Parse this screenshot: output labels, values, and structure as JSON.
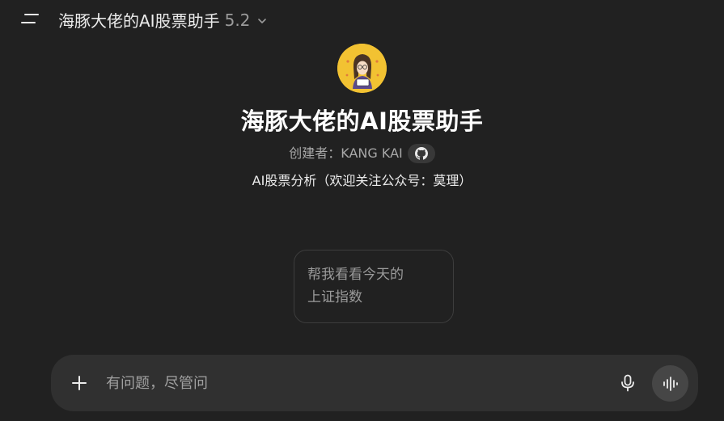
{
  "header": {
    "title": "海豚大佬的AI股票助手",
    "version": "5.2",
    "menu_icon": "sidebar-menu-icon",
    "chevron_icon": "chevron-down-icon"
  },
  "gpt": {
    "avatar_icon": "avatar-image",
    "name": "海豚大佬的AI股票助手",
    "creator_label": "创建者：KANG KAI",
    "github_icon": "github-icon",
    "description": "AI股票分析（欢迎关注公众号：莫理）"
  },
  "starters": [
    {
      "text": "帮我看看今天的上证指数"
    }
  ],
  "composer": {
    "placeholder": "有问题，尽管问",
    "plus_icon": "plus-icon",
    "mic_icon": "microphone-icon",
    "voice_icon": "voice-mode-icon"
  },
  "colors": {
    "background": "#212121",
    "composer_bg": "#303030",
    "avatar_bg": "#f2c232",
    "text_primary": "#ececec",
    "text_secondary": "#9b9b9b"
  }
}
